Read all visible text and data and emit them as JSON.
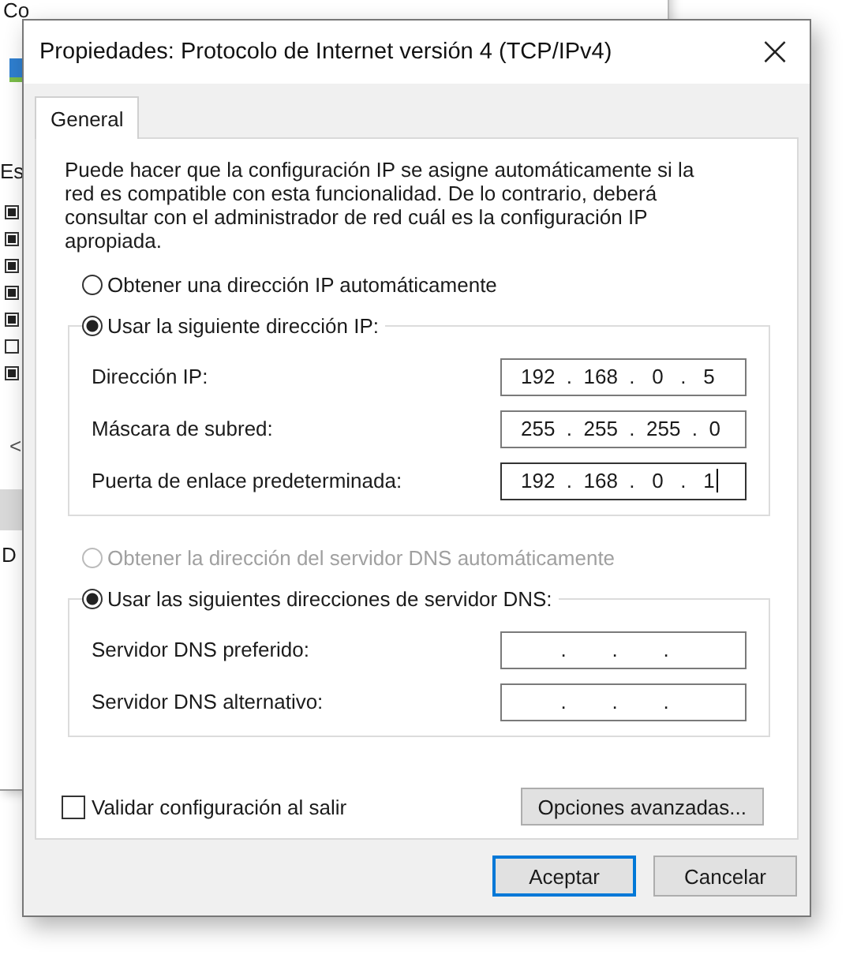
{
  "background_window": {
    "title_fragment": "Co",
    "header_fragment": "Es",
    "checkboxes": [
      {
        "checked": true
      },
      {
        "checked": true
      },
      {
        "checked": true
      },
      {
        "checked": true
      },
      {
        "checked": true
      },
      {
        "checked": false
      },
      {
        "checked": true
      }
    ],
    "scroll_arrow": "<",
    "item_fragment": "D"
  },
  "window": {
    "title": "Propiedades: Protocolo de Internet versión 4 (TCP/IPv4)",
    "close": "×"
  },
  "tabs": [
    {
      "label": "General",
      "selected": true
    }
  ],
  "description": "Puede hacer que la configuración IP se asigne automáticamente si la red es compatible con esta funcionalidad. De lo contrario, deberá consultar con el administrador de red cuál es la configuración IP apropiada.",
  "ip_options": [
    {
      "label": "Obtener una dirección IP automáticamente",
      "selected": false,
      "disabled": false
    },
    {
      "label": "Usar la siguiente dirección IP:",
      "selected": true,
      "disabled": false
    }
  ],
  "ip_fields": [
    {
      "label": "Dirección IP:",
      "value": "192  .  168  .   0   .   5",
      "focused": false
    },
    {
      "label": "Máscara de subred:",
      "value": "255  .  255  .  255  .  0",
      "focused": false
    },
    {
      "label": "Puerta de enlace predeterminada:",
      "value": "192  .  168  .   0   .   1",
      "focused": true
    }
  ],
  "dns_options": [
    {
      "label": "Obtener la dirección del servidor DNS automáticamente",
      "selected": false,
      "disabled": true
    },
    {
      "label": "Usar las siguientes direcciones de servidor DNS:",
      "selected": true,
      "disabled": false
    }
  ],
  "dns_fields": [
    {
      "label": "Servidor DNS preferido:",
      "value": "       .        .        .",
      "focused": false
    },
    {
      "label": "Servidor DNS alternativo:",
      "value": "       .        .        .",
      "focused": false
    }
  ],
  "validate": {
    "label": "Validar configuración al salir",
    "checked": false
  },
  "advanced_button": "Opciones avanzadas...",
  "buttons": [
    {
      "label": "Aceptar",
      "default": true
    },
    {
      "label": "Cancelar",
      "default": false
    }
  ]
}
